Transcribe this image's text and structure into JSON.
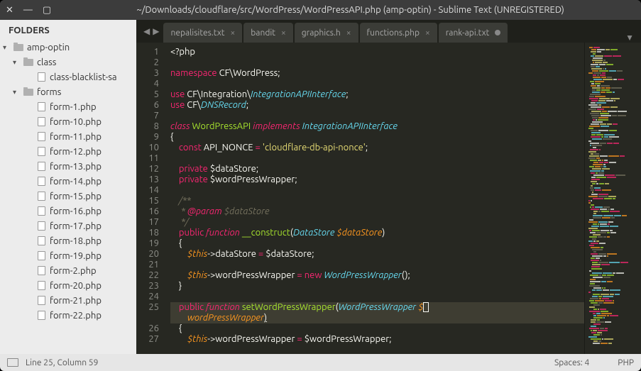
{
  "titlebar": {
    "close": "✕",
    "min": "—",
    "max": "▢",
    "title": "~/Downloads/cloudflare/src/WordPress/WordPressAPI.php (amp-optin) - Sublime Text (UNREGISTERED)"
  },
  "sidebar": {
    "header": "FOLDERS",
    "items": [
      {
        "type": "folder",
        "label": "amp-optin",
        "indent": 0,
        "expanded": true
      },
      {
        "type": "folder",
        "label": "class",
        "indent": 1,
        "expanded": true
      },
      {
        "type": "file",
        "label": "class-blacklist-sa",
        "indent": 2
      },
      {
        "type": "folder",
        "label": "forms",
        "indent": 1,
        "expanded": true
      },
      {
        "type": "file",
        "label": "form-1.php",
        "indent": 2
      },
      {
        "type": "file",
        "label": "form-10.php",
        "indent": 2
      },
      {
        "type": "file",
        "label": "form-11.php",
        "indent": 2
      },
      {
        "type": "file",
        "label": "form-12.php",
        "indent": 2
      },
      {
        "type": "file",
        "label": "form-13.php",
        "indent": 2
      },
      {
        "type": "file",
        "label": "form-14.php",
        "indent": 2
      },
      {
        "type": "file",
        "label": "form-15.php",
        "indent": 2
      },
      {
        "type": "file",
        "label": "form-16.php",
        "indent": 2
      },
      {
        "type": "file",
        "label": "form-17.php",
        "indent": 2
      },
      {
        "type": "file",
        "label": "form-18.php",
        "indent": 2
      },
      {
        "type": "file",
        "label": "form-19.php",
        "indent": 2
      },
      {
        "type": "file",
        "label": "form-2.php",
        "indent": 2
      },
      {
        "type": "file",
        "label": "form-20.php",
        "indent": 2
      },
      {
        "type": "file",
        "label": "form-21.php",
        "indent": 2
      },
      {
        "type": "file",
        "label": "form-22.php",
        "indent": 2
      }
    ]
  },
  "tabs": [
    {
      "label": "nepalisites.txt",
      "dirty": false
    },
    {
      "label": "bandit",
      "dirty": false
    },
    {
      "label": "graphics.h",
      "dirty": false
    },
    {
      "label": "functions.php",
      "dirty": false
    },
    {
      "label": "rank-api.txt",
      "dirty": true
    }
  ],
  "nav": {
    "back": "◀",
    "fwd": "▶",
    "menu": "▼"
  },
  "gutter_start": 1,
  "gutter_end": 27,
  "code": {
    "l1": "<?php",
    "l3_a": "namespace",
    "l3_b": " CF\\WordPress",
    "l5_a": "use",
    "l5_b": " CF\\Integration\\",
    "l5_c": "IntegrationAPIInterface",
    "l6_a": "use",
    "l6_b": " CF\\",
    "l6_c": "DNSRecord",
    "l8_a": "class",
    "l8_b": "WordPressAPI",
    "l8_c": "implements",
    "l8_d": "IntegrationAPIInterface",
    "l10_a": "const",
    "l10_b": "API_NONCE",
    "l10_c": "'cloudflare-db-api-nonce'",
    "l12_a": "private",
    "l12_b": "$dataStore",
    "l13_a": "private",
    "l13_b": "$wordPressWrapper",
    "l15": "/**",
    "l16_a": " * ",
    "l16_b": "@param",
    "l16_c": " $dataStore",
    "l17": " */",
    "l18_a": "public",
    "l18_b": "function",
    "l18_c": "__construct",
    "l18_d": "DataStore",
    "l18_e": "$dataStore",
    "l20_a": "$this",
    "l20_b": "->dataStore ",
    "l20_c": "=",
    "l20_d": " $dataStore;",
    "l22_a": "$this",
    "l22_b": "->wordPressWrapper ",
    "l22_c": "=",
    "l22_d": "new",
    "l22_e": "WordPressWrapper",
    "l25_a": "public",
    "l25_b": "function",
    "l25_c": "setWordPressWrapper",
    "l25_d": "WordPressWrapper",
    "l25_e": "$",
    "l25x": "wordPressWrapper",
    "l27_a": "$this",
    "l27_b": "->wordPressWrapper ",
    "l27_c": "=",
    "l27_d": " $wordPressWrapper;"
  },
  "statusbar": {
    "pos": "Line 25, Column 59",
    "spaces": "Spaces: 4",
    "lang": "PHP"
  }
}
